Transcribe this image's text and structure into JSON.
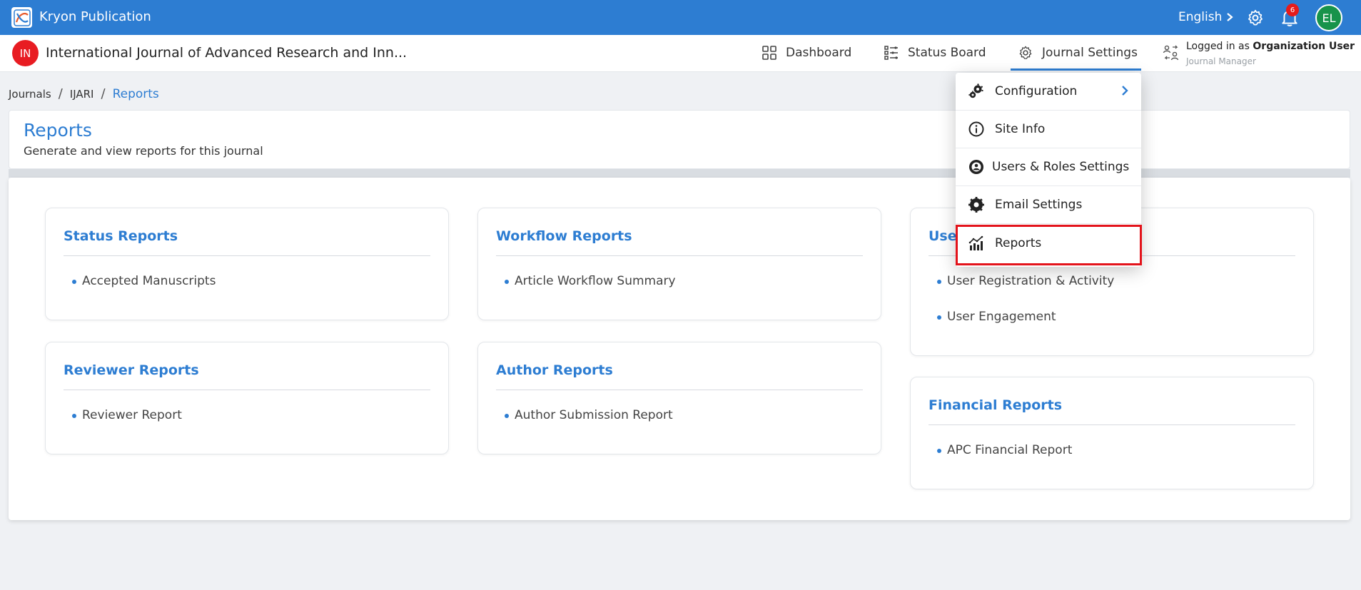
{
  "app": {
    "title": "Kryon Publication",
    "language": "English",
    "notification_count": "6",
    "avatar_initials": "EL"
  },
  "journal": {
    "badge": "IN",
    "name": "International Journal of Advanced Research and Inn...",
    "nav": {
      "dashboard": "Dashboard",
      "status_board": "Status Board",
      "journal_settings": "Journal Settings"
    },
    "logged_prefix": "Logged in as ",
    "logged_user": "Organization User",
    "role": "Journal Manager"
  },
  "breadcrumb": {
    "journals": "Journals",
    "ijari": "IJARI",
    "current": "Reports",
    "sep": "/"
  },
  "header": {
    "title": "Reports",
    "subtitle": "Generate and view reports for this journal"
  },
  "cards": {
    "status": {
      "title": "Status Reports",
      "items": [
        "Accepted Manuscripts"
      ]
    },
    "workflow": {
      "title": "Workflow Reports",
      "items": [
        "Article Workflow Summary"
      ]
    },
    "user": {
      "title": "Use",
      "items": [
        "User Registration & Activity",
        "User Engagement"
      ]
    },
    "reviewer": {
      "title": "Reviewer Reports",
      "items": [
        "Reviewer Report"
      ]
    },
    "author": {
      "title": "Author Reports",
      "items": [
        "Author Submission Report"
      ]
    },
    "financial": {
      "title": "Financial Reports",
      "items": [
        "APC Financial Report"
      ]
    }
  },
  "dropdown": {
    "configuration": "Configuration",
    "site_info": "Site Info",
    "users_roles": "Users & Roles Settings",
    "email_settings": "Email Settings",
    "reports": "Reports"
  },
  "colors": {
    "primary": "#2d7dd2",
    "highlight": "#e3131b",
    "journal_badge": "#e81c22",
    "avatar": "#17934b"
  },
  "icons": {
    "app_logo": "app-logo-icon",
    "settings": "gear-icon",
    "notifications": "bell-icon",
    "dashboard": "grid-icon",
    "status_board": "board-icon",
    "journal_settings": "gear-icon",
    "logged_in": "users-switch-icon",
    "configuration": "gears-icon",
    "site_info": "info-icon",
    "users_roles": "user-gear-icon",
    "email_settings": "gear-icon",
    "reports": "bar-chart-icon"
  }
}
